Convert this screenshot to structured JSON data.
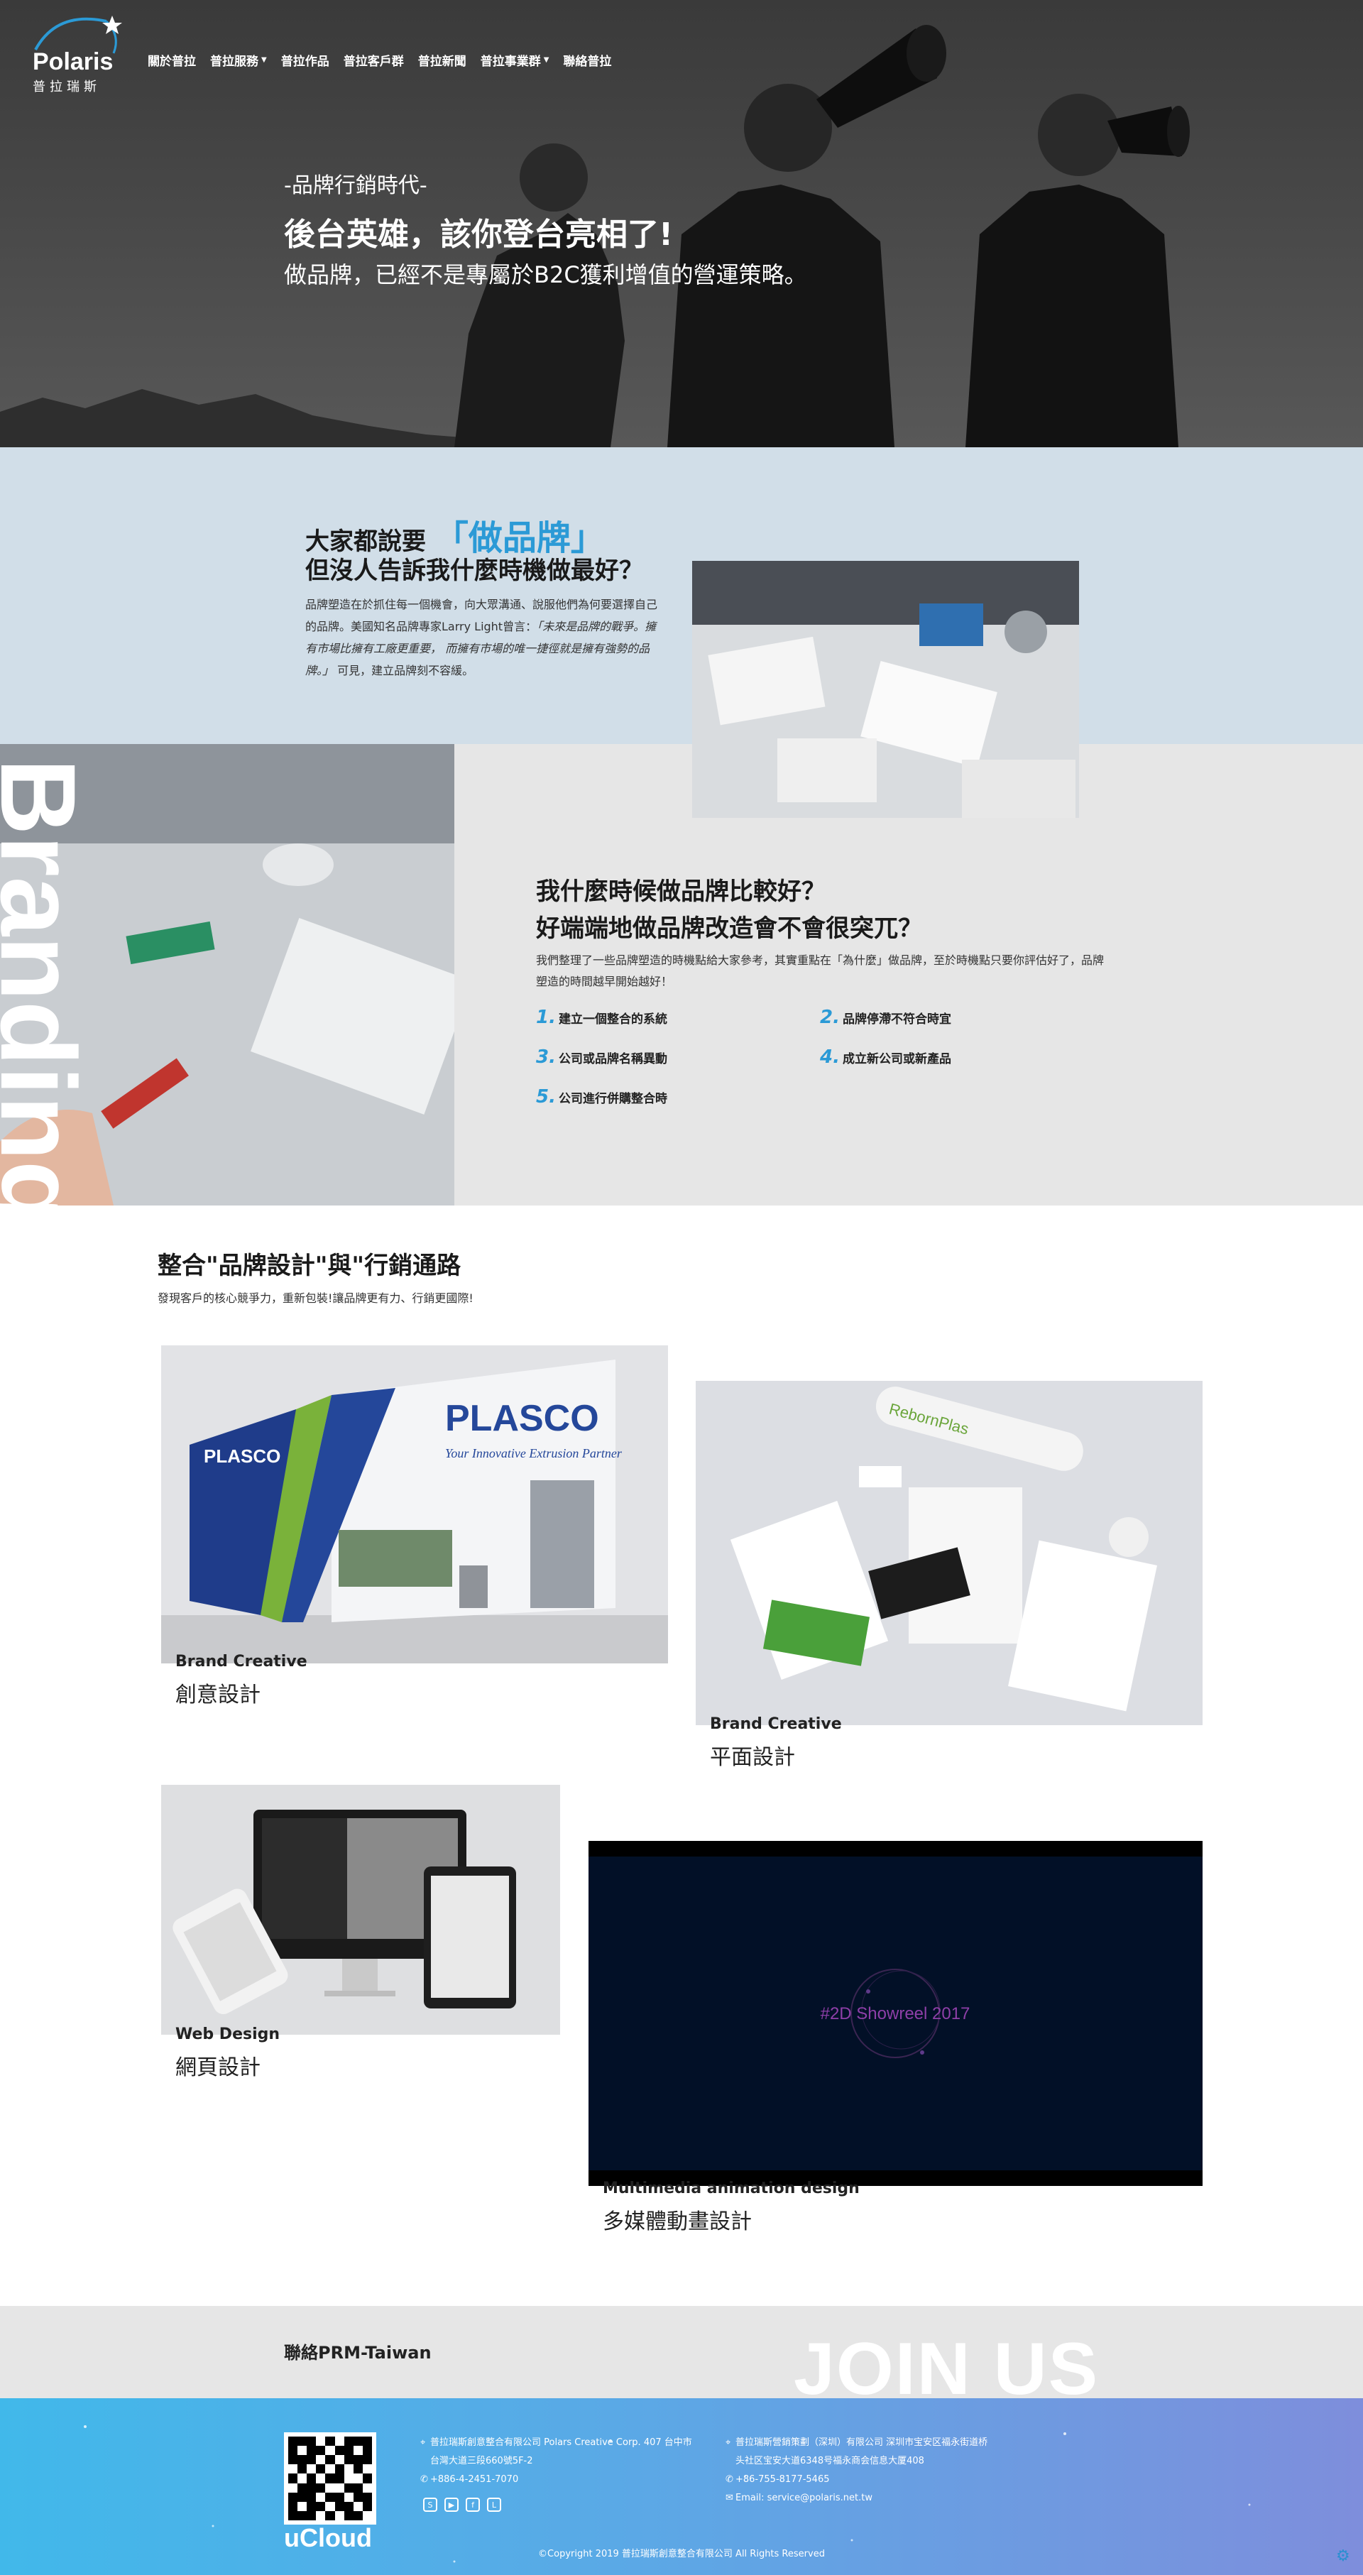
{
  "brand": {
    "name_en": "Polaris",
    "name_zh": "普拉瑞斯"
  },
  "nav": [
    {
      "label": "關於普拉",
      "caret": false
    },
    {
      "label": "普拉服務",
      "caret": true
    },
    {
      "label": "普拉作品",
      "caret": false
    },
    {
      "label": "普拉客戶群",
      "caret": false
    },
    {
      "label": "普拉新聞",
      "caret": false
    },
    {
      "label": "普拉事業群",
      "caret": true
    },
    {
      "label": "聯絡普拉",
      "caret": false
    }
  ],
  "hero": {
    "subtitle": "-品牌行銷時代-",
    "headline": "後台英雄，該你登台亮相了!",
    "tagline": "做品牌，已經不是專屬於B2C獲利增值的營運策略。"
  },
  "intro": {
    "line1_prefix": "大家都說要",
    "line1_accent": "「做品牌」",
    "line2": "但沒人告訴我什麼時機做最好？",
    "para_a": "品牌塑造在於抓住每一個機會，向大眾溝通、說服他們為何要選擇自己的品牌。美國知名品牌專家Larry Light曾言：",
    "para_quote": "「未來是品牌的戰爭。擁有市場比擁有工廠更重要， 而擁有市場的唯一捷徑就是擁有強勢的品牌。」",
    "para_b": " 可見，建立品牌刻不容緩。"
  },
  "timing": {
    "side_text": "Branding",
    "q1": "我什麼時候做品牌比較好？",
    "q2": "好端端地做品牌改造會不會很突兀？",
    "para": "我們整理了一些品牌塑造的時機點給大家參考，其實重點在「為什麼」做品牌，至於時機點只要你評估好了，品牌塑造的時間越早開始越好！",
    "items": [
      {
        "num": "1.",
        "text": "建立一個整合的系統"
      },
      {
        "num": "2.",
        "text": "品牌停滯不符合時宜"
      },
      {
        "num": "3.",
        "text": "公司或品牌名稱異動"
      },
      {
        "num": "4.",
        "text": "成立新公司或新產品"
      },
      {
        "num": "5.",
        "text": "公司進行併購整合時"
      }
    ]
  },
  "integrate": {
    "title": "整合\"品牌設計\"與\"行銷通路",
    "subtitle": "發現客戶的核心競爭力，重新包裝!讓品牌更有力、行銷更國際!"
  },
  "cards": [
    {
      "en": "Brand Creative",
      "zh": "創意設計",
      "img_text": "PLASCO",
      "img_sub": "Your Innovative Extrusion Partner"
    },
    {
      "en": "Brand Creative",
      "zh": "平面設計",
      "img_text": "RebornPlas"
    },
    {
      "en": "Web Design",
      "zh": "網頁設計"
    },
    {
      "en": "Multimedia animation design",
      "zh": "多媒體動畫設計",
      "img_text": "#2D Showreel 2017"
    }
  ],
  "join": {
    "contact": "聯絡PRM-Taiwan",
    "big": "JOIN US"
  },
  "footer": {
    "ucloud": "uCloud",
    "tw_address_1": "普拉瑞斯創意整合有限公司 Polars Creative Corp. 407 台中市",
    "tw_address_2": "台灣大道三段660號5F-2",
    "tw_phone": "+886-4-2451-7070",
    "cn_address_1": "普拉瑞斯營銷策劃（深圳）有限公司 深圳市宝安区福永街道桥",
    "cn_address_2": "头社区宝安大道6348号福永商会信息大厦408",
    "cn_phone": "+86-755-8177-5465",
    "email": "Email: service@polaris.net.tw",
    "social": [
      "skype-icon",
      "youtube-icon",
      "facebook-icon",
      "line-icon"
    ],
    "copyright": "©Copyright 2019 普拉瑞斯創意整合有限公司 All Rights Reserved"
  },
  "colors": {
    "accent": "#2b9ad6",
    "footer_start": "#41b8ea",
    "footer_end": "#7e8edc",
    "section_blue": "#d1dee8",
    "section_gray": "#e6e6e6"
  }
}
